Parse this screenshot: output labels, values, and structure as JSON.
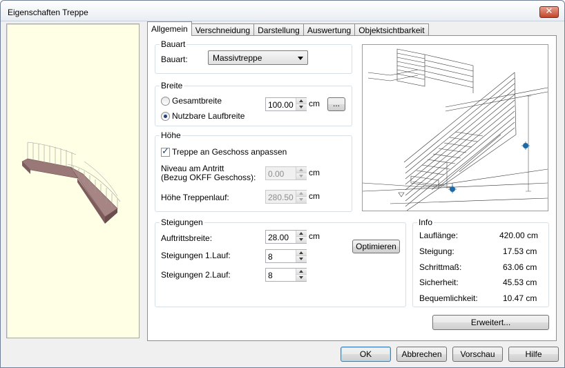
{
  "window": {
    "title": "Eigenschaften Treppe",
    "close_label": "✕"
  },
  "tabs": [
    {
      "label": "Allgemein",
      "active": true
    },
    {
      "label": "Verschneidung"
    },
    {
      "label": "Darstellung"
    },
    {
      "label": "Auswertung"
    },
    {
      "label": "Objektsichtbarkeit"
    }
  ],
  "bauart": {
    "group_label": "Bauart",
    "label": "Bauart:",
    "selected": "Massivtreppe"
  },
  "breite": {
    "group_label": "Breite",
    "option1": "Gesamtbreite",
    "option2": "Nutzbare Laufbreite",
    "selected": "Nutzbare Laufbreite",
    "value": "100.00",
    "unit": "cm",
    "more_button": "..."
  },
  "hoehe": {
    "group_label": "Höhe",
    "checkbox_label": "Treppe an Geschoss anpassen",
    "checked": true,
    "niveau_label_1": "Niveau am Antritt",
    "niveau_label_2": "(Bezug OKFF Geschoss):",
    "niveau_value": "0.00",
    "niveau_unit": "cm",
    "treppenlauf_label": "Höhe Treppenlauf:",
    "treppenlauf_value": "280.50",
    "treppenlauf_unit": "cm"
  },
  "steigungen": {
    "group_label": "Steigungen",
    "auftritt_label": "Auftrittsbreite:",
    "auftritt_value": "28.00",
    "auftritt_unit": "cm",
    "lauf1_label": "Steigungen 1.Lauf:",
    "lauf1_value": "8",
    "lauf2_label": "Steigungen 2.Lauf:",
    "lauf2_value": "8",
    "optimize_button": "Optimieren"
  },
  "info": {
    "group_label": "Info",
    "rows": [
      {
        "label": "Lauflänge:",
        "value": "420.00 cm"
      },
      {
        "label": "Steigung:",
        "value": "17.53 cm"
      },
      {
        "label": "Schrittmaß:",
        "value": "63.06 cm"
      },
      {
        "label": "Sicherheit:",
        "value": "45.53 cm"
      },
      {
        "label": "Bequemlichkeit:",
        "value": "10.47 cm"
      }
    ]
  },
  "buttons": {
    "advanced": "Erweitert...",
    "ok": "OK",
    "cancel": "Abbrechen",
    "preview": "Vorschau",
    "help": "Hilfe"
  },
  "colors": {
    "preview_bg": "#ffffe6",
    "stair_body": "#9b7878",
    "marker": "#1e6aa8"
  }
}
